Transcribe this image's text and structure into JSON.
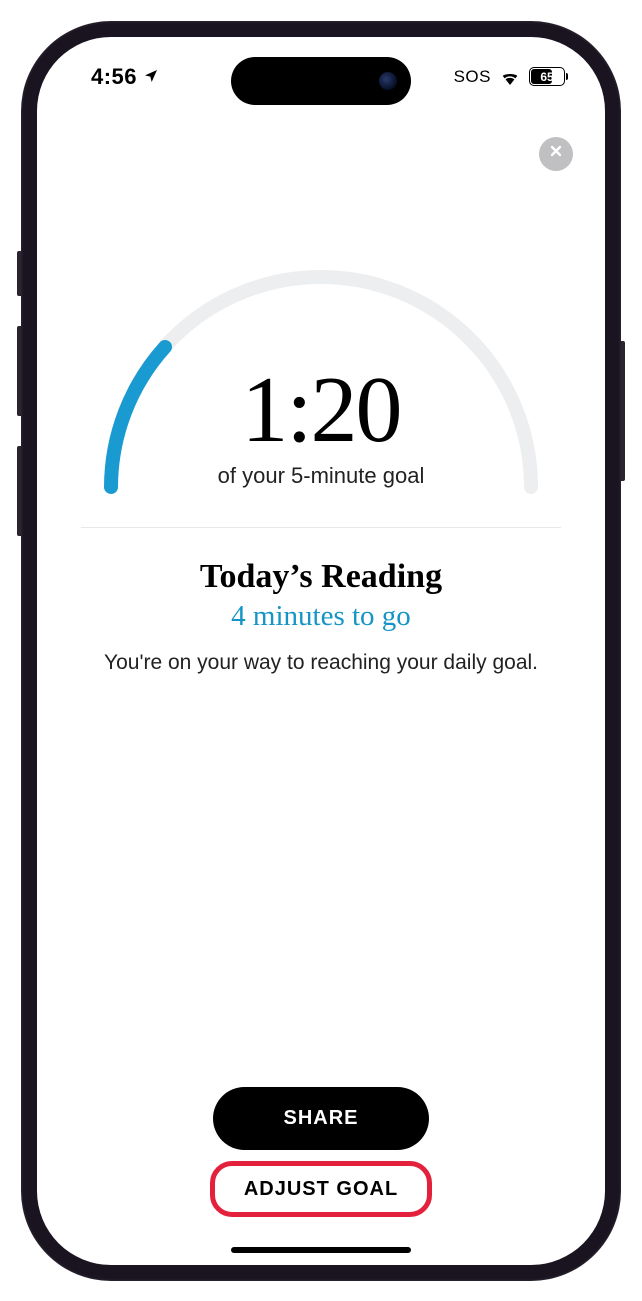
{
  "status": {
    "time": "4:56",
    "sos": "SOS",
    "battery": "65"
  },
  "gauge": {
    "time_elapsed": "1:20",
    "subtitle": "of your 5-minute goal"
  },
  "summary": {
    "heading": "Today’s Reading",
    "remaining": "4 minutes to go",
    "body": "You're on your way to reaching your daily goal."
  },
  "actions": {
    "share": "SHARE",
    "adjust": "ADJUST GOAL"
  },
  "colors": {
    "accent": "#1595c6",
    "highlight": "#e3213c"
  },
  "chart_data": {
    "type": "gauge",
    "goal_minutes": 5,
    "elapsed_minutes": 1.33,
    "remaining_minutes": 4,
    "fraction_complete": 0.27
  }
}
